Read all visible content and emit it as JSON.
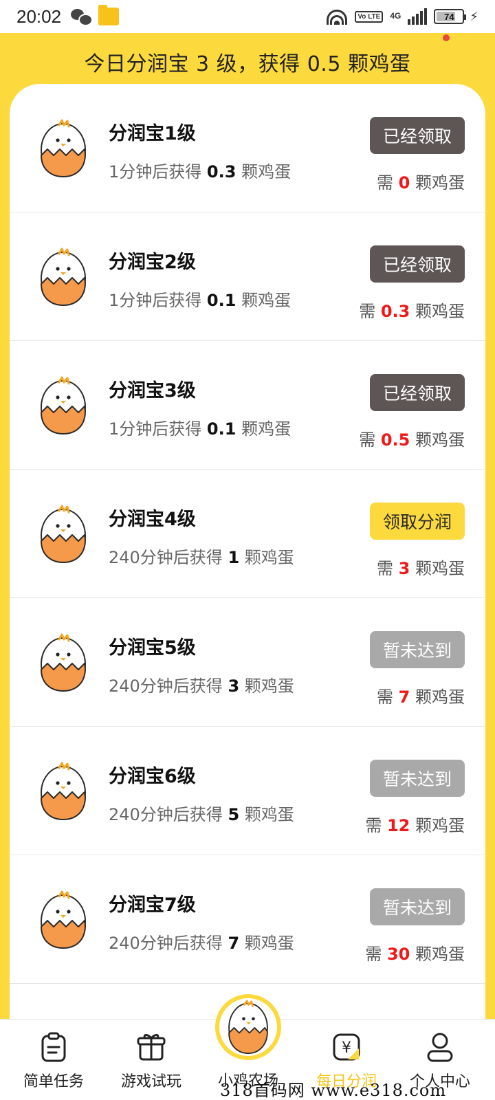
{
  "status_bar": {
    "time": "20:02",
    "network_label": "4G",
    "volte_label": "Vo LTE",
    "battery": "74",
    "battery_level": 0.74
  },
  "header": {
    "title": "今日分润宝 3 级，获得 0.5 颗鸡蛋"
  },
  "levels": [
    {
      "title": "分润宝1级",
      "desc_prefix": "1分钟后获得",
      "reward": "0.3",
      "desc_suffix": "颗鸡蛋",
      "button": "已经领取",
      "button_state": "claimed",
      "need_prefix": "需",
      "need": "0",
      "need_suffix": "颗鸡蛋"
    },
    {
      "title": "分润宝2级",
      "desc_prefix": "1分钟后获得",
      "reward": "0.1",
      "desc_suffix": "颗鸡蛋",
      "button": "已经领取",
      "button_state": "claimed",
      "need_prefix": "需",
      "need": "0.3",
      "need_suffix": "颗鸡蛋"
    },
    {
      "title": "分润宝3级",
      "desc_prefix": "1分钟后获得",
      "reward": "0.1",
      "desc_suffix": "颗鸡蛋",
      "button": "已经领取",
      "button_state": "claimed",
      "need_prefix": "需",
      "need": "0.5",
      "need_suffix": "颗鸡蛋"
    },
    {
      "title": "分润宝4级",
      "desc_prefix": "240分钟后获得",
      "reward": "1",
      "desc_suffix": "颗鸡蛋",
      "button": "领取分润",
      "button_state": "claim",
      "need_prefix": "需",
      "need": "3",
      "need_suffix": "颗鸡蛋"
    },
    {
      "title": "分润宝5级",
      "desc_prefix": "240分钟后获得",
      "reward": "3",
      "desc_suffix": "颗鸡蛋",
      "button": "暂未达到",
      "button_state": "locked",
      "need_prefix": "需",
      "need": "7",
      "need_suffix": "颗鸡蛋"
    },
    {
      "title": "分润宝6级",
      "desc_prefix": "240分钟后获得",
      "reward": "5",
      "desc_suffix": "颗鸡蛋",
      "button": "暂未达到",
      "button_state": "locked",
      "need_prefix": "需",
      "need": "12",
      "need_suffix": "颗鸡蛋"
    },
    {
      "title": "分润宝7级",
      "desc_prefix": "240分钟后获得",
      "reward": "7",
      "desc_suffix": "颗鸡蛋",
      "button": "暂未达到",
      "button_state": "locked",
      "need_prefix": "需",
      "need": "30",
      "need_suffix": "颗鸡蛋"
    }
  ],
  "bottom_nav": {
    "items": [
      {
        "label": "简单任务",
        "icon": "clipboard-icon"
      },
      {
        "label": "游戏试玩",
        "icon": "gift-box-icon"
      },
      {
        "label": "小鸡农场",
        "icon": "chick-egg-icon"
      },
      {
        "label": "每日分润",
        "icon": "yuan-icon",
        "active": true
      },
      {
        "label": "个人中心",
        "icon": "user-icon"
      }
    ]
  },
  "watermark": "318首码网 www.e318.com",
  "colors": {
    "brand_yellow": "#fcd93d",
    "claimed_button": "#5e5655",
    "locked_button": "#a9a9a9",
    "need_red": "#f01818",
    "egg_orange": "#f59a4a"
  }
}
